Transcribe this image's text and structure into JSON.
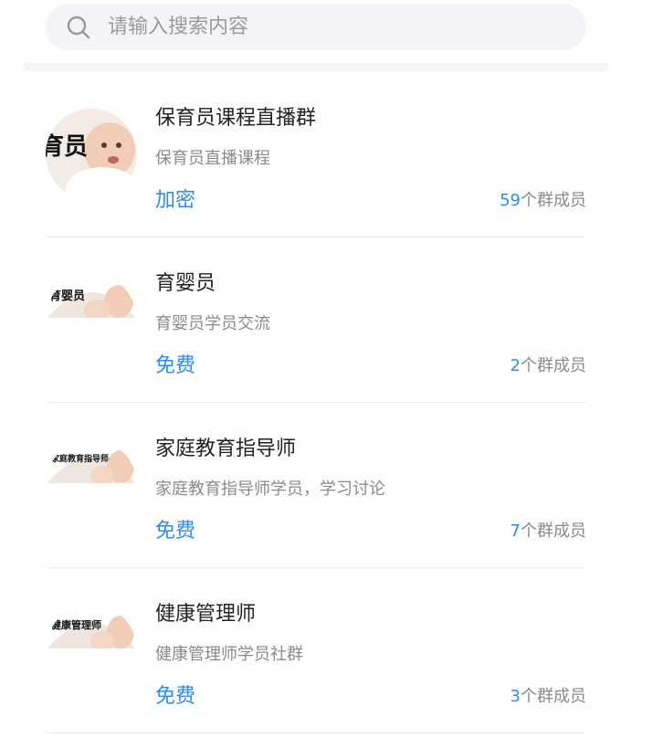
{
  "search": {
    "placeholder": "请输入搜索内容",
    "icon": "search-icon"
  },
  "groups": [
    {
      "name": "保育员课程直播群",
      "description": "保育员直播课程",
      "price": "加密",
      "members": "59",
      "members_suffix": "个群成员",
      "avatar_text": "育员"
    },
    {
      "name": "育婴员",
      "description": "育婴员学员交流",
      "price": "免费",
      "members": "2",
      "members_suffix": "个群成员",
      "avatar_text": "育婴员"
    },
    {
      "name": "家庭教育指导师",
      "description": "家庭教育指导师学员，学习讨论",
      "price": "免费",
      "members": "7",
      "members_suffix": "个群成员",
      "avatar_text": "家庭教育指导师"
    },
    {
      "name": "健康管理师",
      "description": "健康管理师学员社群",
      "price": "免费",
      "members": "3",
      "members_suffix": "个群成员",
      "avatar_text": "健康管理师"
    }
  ],
  "colors": {
    "accent": "#2d8cf0",
    "search_bg": "#f2f4f8",
    "muted_text": "#8a8a8a"
  }
}
